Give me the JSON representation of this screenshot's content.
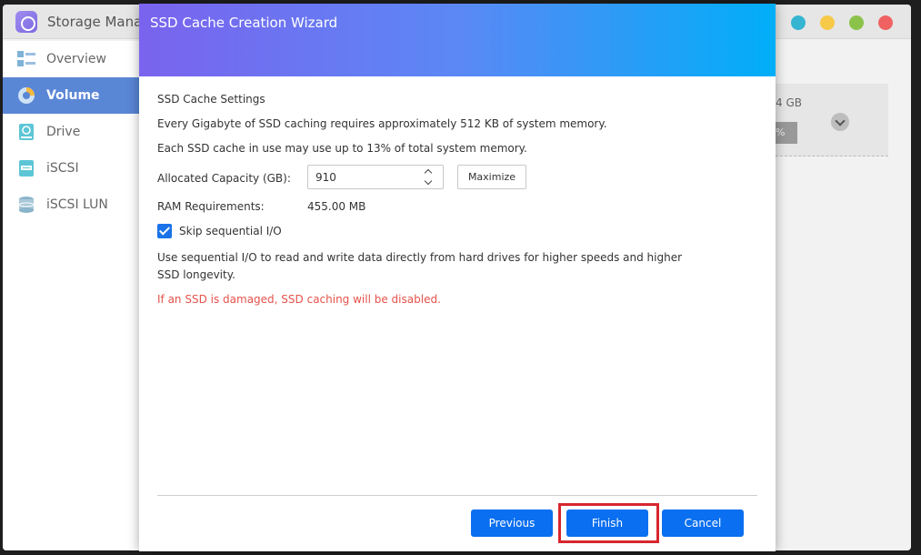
{
  "app": {
    "title": "Storage Manag",
    "dots": [
      "#35b5d1",
      "#f7c948",
      "#8bc34a",
      "#f06262"
    ]
  },
  "sidebar": {
    "items": [
      {
        "label": "Overview",
        "icon": "overview-icon",
        "active": false
      },
      {
        "label": "Volume",
        "icon": "volume-icon",
        "active": true
      },
      {
        "label": "Drive",
        "icon": "drive-icon",
        "active": false
      },
      {
        "label": "iSCSI",
        "icon": "iscsi-icon",
        "active": false
      },
      {
        "label": "iSCSI LUN",
        "icon": "iscsi-lun-icon",
        "active": false
      }
    ]
  },
  "background_card": {
    "capacity": "4 GB",
    "percent": "%"
  },
  "dialog": {
    "title": "SSD Cache Creation Wizard",
    "section_title": "SSD Cache Settings",
    "info_line1": "Every Gigabyte of SSD caching requires approximately 512 KB of system memory.",
    "info_line2": "Each SSD cache in use may use up to 13% of total system memory.",
    "allocated_label": "Allocated Capacity (GB):",
    "allocated_value": "910",
    "maximize_label": "Maximize",
    "ram_label": "RAM Requirements:",
    "ram_value": "455.00 MB",
    "skip_label": "Skip sequential I/O",
    "skip_checked": true,
    "description": "Use sequential I/O to read and write data directly from hard drives for higher speeds and higher SSD longevity.",
    "warning": "If an SSD is damaged, SSD caching will be disabled.",
    "buttons": {
      "previous": "Previous",
      "finish": "Finish",
      "cancel": "Cancel"
    }
  },
  "colors": {
    "primary_button": "#0a6ff0",
    "warning_text": "#e5534b",
    "highlight_box": "#d7262e",
    "sidebar_active": "#5a86d6"
  }
}
